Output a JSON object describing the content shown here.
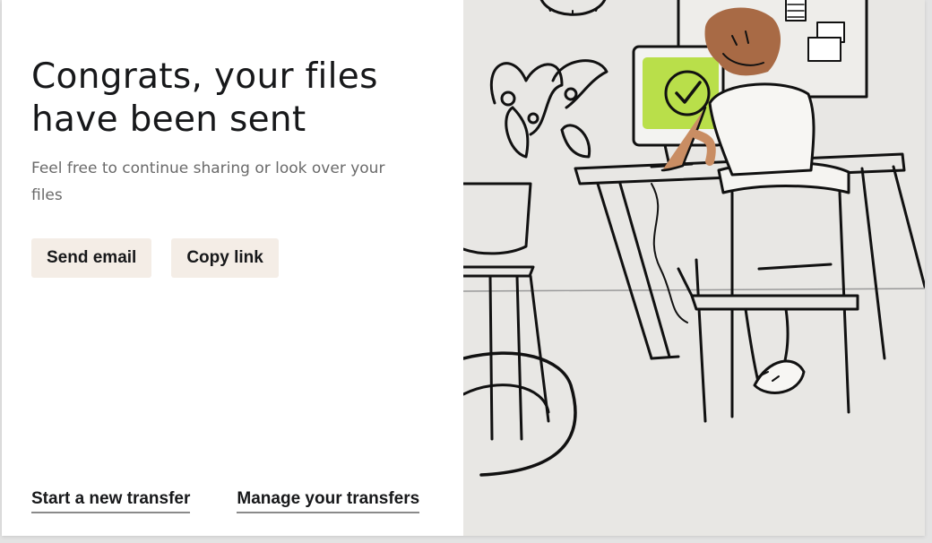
{
  "main": {
    "title": "Congrats, your files have been sent",
    "subtitle": "Feel free to continue sharing or look over your files",
    "actions": {
      "send_email": "Send email",
      "copy_link": "Copy link"
    },
    "links": {
      "new_transfer": "Start a new transfer",
      "manage_transfers": "Manage your transfers"
    }
  },
  "colors": {
    "button_bg": "#f4ede6",
    "illustration_bg": "#e8e7e4",
    "screen_green": "#b9df4a",
    "hair_brown": "#a86a45",
    "skin": "#c98d63"
  },
  "illustration": {
    "icon": "person-at-desk-checkmark-illustration"
  }
}
